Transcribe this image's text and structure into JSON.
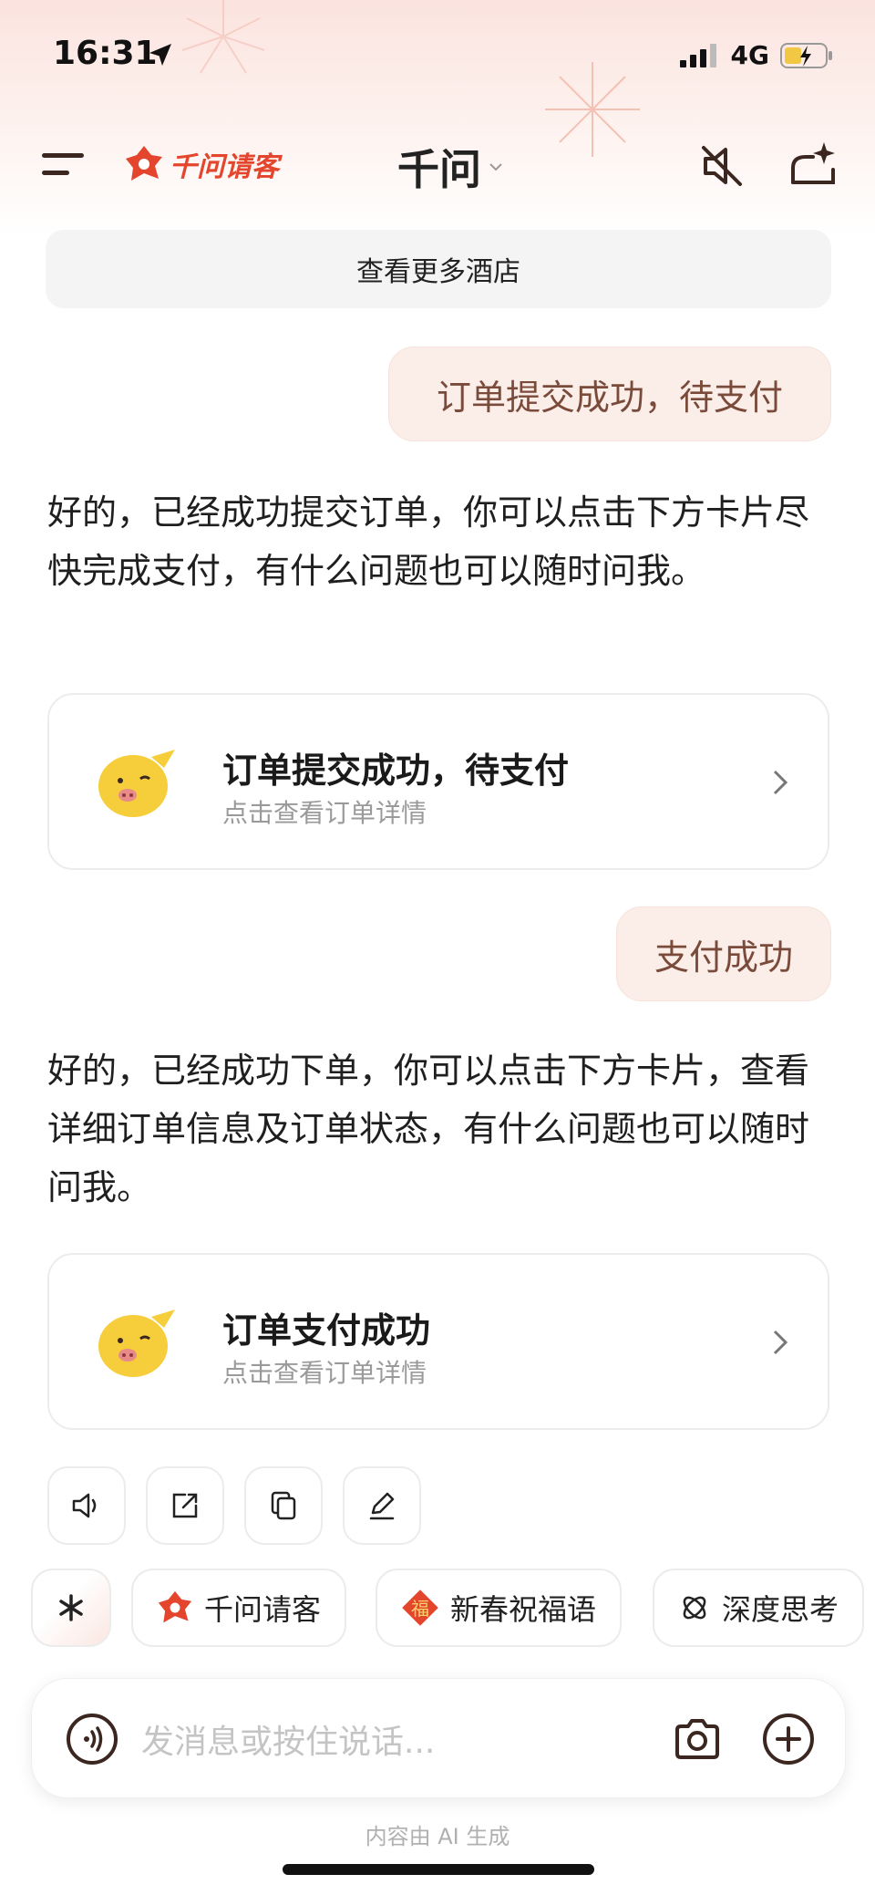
{
  "status": {
    "time": "16:31",
    "network": "4G"
  },
  "nav": {
    "brand": "千问请客",
    "title": "千问"
  },
  "hotels": {
    "more_label": "查看更多酒店"
  },
  "messages": {
    "user1": "订单提交成功，待支付",
    "bot1": "好的，已经成功提交订单，你可以点击下方卡片尽快完成支付，有什么问题也可以随时问我。",
    "card1_title": "订单提交成功，待支付",
    "card1_sub": "点击查看订单详情",
    "user2": "支付成功",
    "bot2": "好的，已经成功下单，你可以点击下方卡片，查看详细订单信息及订单状态，有什么问题也可以随时问我。",
    "card2_title": "订单支付成功",
    "card2_sub": "点击查看订单详情"
  },
  "chips": {
    "items": [
      "千问请客",
      "新春祝福语",
      "深度思考"
    ],
    "fu_char": "福"
  },
  "input": {
    "placeholder": "发消息或按住说话..."
  },
  "footer": {
    "note": "内容由 AI 生成"
  },
  "colors": {
    "accent": "#e4452d",
    "bubble_bg": "#fbeee9",
    "bubble_text": "#7a4a3a",
    "icon_brown": "#3b2620",
    "pig_yellow": "#f6cd3a"
  }
}
